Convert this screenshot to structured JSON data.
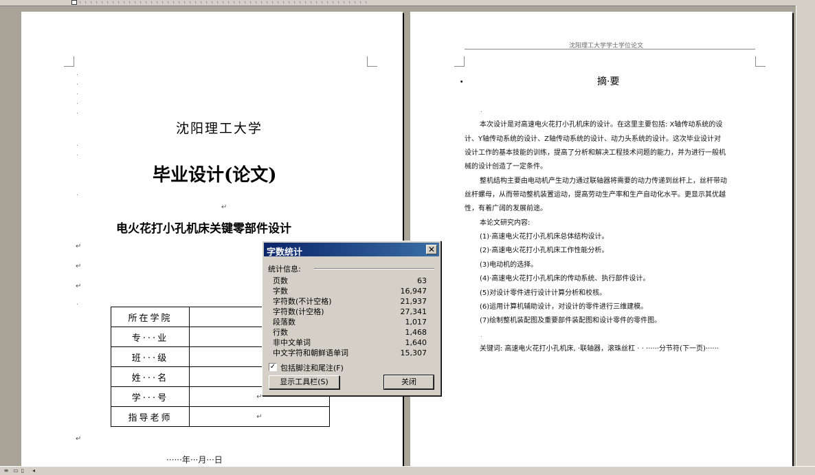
{
  "cover": {
    "university": "沈阳理工大学",
    "doc_type": "毕业设计(论文)",
    "thesis_title": "电火花打小孔机床关键零部件设计",
    "info_rows": [
      {
        "label": "所在学院"
      },
      {
        "label": "专···业"
      },
      {
        "label": "班···级"
      },
      {
        "label": "姓···名"
      },
      {
        "label": "学···号"
      },
      {
        "label": "指导老师"
      }
    ],
    "date_line": "······年···月···日",
    "return_mark": "↵"
  },
  "abstract_page": {
    "header": "沈阳理工大学学士学位论文",
    "title": "摘·要",
    "lines": [
      "本次设计是对高速电火花打小孔机床的设计。在这里主要包括: X轴传动系统的设",
      "计、Y轴传动系统的设计、Z轴传动系统的设计、动力头系统的设计。这次毕业设计对",
      "设计工作的基本技能的训练，提高了分析和解决工程技术问题的能力，并为进行一般机",
      "械的设计创造了一定条件。",
      "整机结构主要由电动机产生动力通过联轴器将需要的动力传递到丝杆上，丝杆带动",
      "丝杆螺母，从而带动整机装置运动，提高劳动生产率和生产自动化水平。更显示其优越",
      "性，有着广阔的发展前途。",
      "本论文研究内容:",
      "(1)·高速电火花打小孔机床总体结构设计。",
      "(2)·高速电火花打小孔机床工作性能分析。",
      "(3)电动机的选择。",
      "(4)·高速电火花打小孔机床的传动系统、执行部件设计。",
      "(5)对设计零件进行设计计算分析和校核。",
      "(6)运用计算机辅助设计，对设计的零件进行三维建模。",
      "(7)绘制整机装配图及重要部件装配图和设计零件的零件图。",
      "",
      "关键词: 高速电火花打小孔机床, ·联轴器，滚珠丝杠 ·  ·  ······分节符(下一页)······"
    ]
  },
  "dialog": {
    "title": "字数统计",
    "close_glyph": "✕",
    "group_label": "统计信息:",
    "stats": [
      {
        "label": "页数",
        "value": "63"
      },
      {
        "label": "字数",
        "value": "16,947"
      },
      {
        "label": "字符数(不计空格)",
        "value": "21,937"
      },
      {
        "label": "字符数(计空格)",
        "value": "27,341"
      },
      {
        "label": "段落数",
        "value": "1,017"
      },
      {
        "label": "行数",
        "value": "1,468"
      },
      {
        "label": "非中文单词",
        "value": "1,640"
      },
      {
        "label": "中文字符和朝鲜语单词",
        "value": "15,307"
      }
    ],
    "include_footnotes_label": "包括脚注和尾注(F)",
    "include_footnotes_checked": true,
    "show_toolbar_button": "显示工具栏(S)",
    "close_button": "关闭"
  },
  "colors": {
    "workspace": "#a8a497",
    "dialog_face": "#d4d0c8",
    "titlebar": "#0a246a"
  }
}
